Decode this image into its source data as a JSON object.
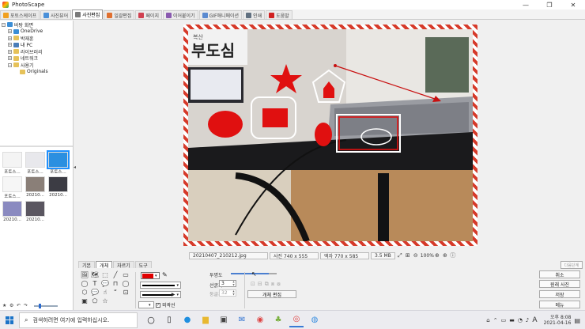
{
  "window": {
    "title": "PhotoScape",
    "minimize": "—",
    "maximize": "❐",
    "close": "✕"
  },
  "tabs": [
    {
      "label": "포토스케이프",
      "color": "#f0a020"
    },
    {
      "label": "사진뷰어",
      "color": "#4a90d9"
    },
    {
      "label": "사진편집",
      "color": "#7a7a7a",
      "active": true
    },
    {
      "label": "일괄편집",
      "color": "#e07030"
    },
    {
      "label": "페이지",
      "color": "#d04050"
    },
    {
      "label": "이어붙이기",
      "color": "#8a5ab0"
    },
    {
      "label": "GIF애니메이션",
      "color": "#5a8ad0"
    },
    {
      "label": "인쇄",
      "color": "#607080"
    },
    {
      "label": "도움말",
      "color": "#d02020"
    }
  ],
  "tree": [
    {
      "label": "바탕 화면",
      "indent": 0,
      "toggle": "−",
      "kind": "blue"
    },
    {
      "label": "OneDrive",
      "indent": 1,
      "toggle": "+",
      "kind": "blue"
    },
    {
      "label": "박재훈",
      "indent": 1,
      "toggle": "+",
      "kind": "yellow"
    },
    {
      "label": "내 PC",
      "indent": 1,
      "toggle": "+",
      "kind": "pc"
    },
    {
      "label": "라이브러리",
      "indent": 1,
      "toggle": "+",
      "kind": "yellow"
    },
    {
      "label": "네트워크",
      "indent": 1,
      "toggle": "+",
      "kind": "yellow"
    },
    {
      "label": "사용기",
      "indent": 1,
      "toggle": "−",
      "kind": "yellow"
    },
    {
      "label": "Originals",
      "indent": 2,
      "toggle": "",
      "kind": "yellow"
    }
  ],
  "thumbnails": [
    {
      "label": "포토스...",
      "fill": "#f4f4f4",
      "selected": false
    },
    {
      "label": "포토스...",
      "fill": "#e8e8ec",
      "selected": false
    },
    {
      "label": "포토스...",
      "fill": "#2b8fe0",
      "selected": true
    },
    {
      "label": "포토스...",
      "fill": "#f6f6f6",
      "selected": false
    },
    {
      "label": "20210...",
      "fill": "#8a7f78",
      "selected": false
    },
    {
      "label": "20210...",
      "fill": "#3c3c44",
      "selected": false
    },
    {
      "label": "20210...",
      "fill": "#8a8ac0",
      "selected": false
    },
    {
      "label": "20210...",
      "fill": "#5a5660",
      "selected": false
    }
  ],
  "leftpanel_icons": [
    "★",
    "⚙",
    "↶",
    "↷"
  ],
  "status": {
    "filename": "20210407_210212.jpg",
    "photo_size": "사진 740 x 555",
    "frame_size": "액자 770 x 585",
    "file_size": "3.5 MB",
    "zoom": "100%"
  },
  "photo": {
    "sign_text": "부도심",
    "sign_small": "복산"
  },
  "tool_panel": {
    "subtabs": [
      "기본",
      "개체",
      "자르기",
      "도구"
    ],
    "active_subtab": 1,
    "tools": [
      "🖼",
      "🗺",
      "⬚",
      "╱",
      "▭",
      "◯",
      "T",
      "💬",
      "⊓",
      "◯",
      "⬡",
      "💬",
      "☝",
      "“",
      "⊡",
      "▣",
      "⬠",
      "☆",
      "",
      "",
      "",
      "",
      "",
      "",
      ""
    ],
    "color_value": "#e00000",
    "opacity_label": "투명도",
    "opacity_value": 0.82,
    "line_width_label": "선굵기",
    "line_width_value": "3",
    "round_label": "둥글기",
    "round_value": "32",
    "outline_label": "외곽선",
    "object_edit_button": "개체 편집"
  },
  "side_buttons": {
    "cancel": "취소",
    "original": "원래 사진",
    "save": "저장",
    "menu": "메뉴",
    "undo": "이전",
    "redo": "다음단계"
  },
  "taskbar": {
    "search_placeholder": "검색하려면 여기에 입력하십시오.",
    "time": "오후 8:08",
    "date": "2021-04-16",
    "lang": "A"
  }
}
